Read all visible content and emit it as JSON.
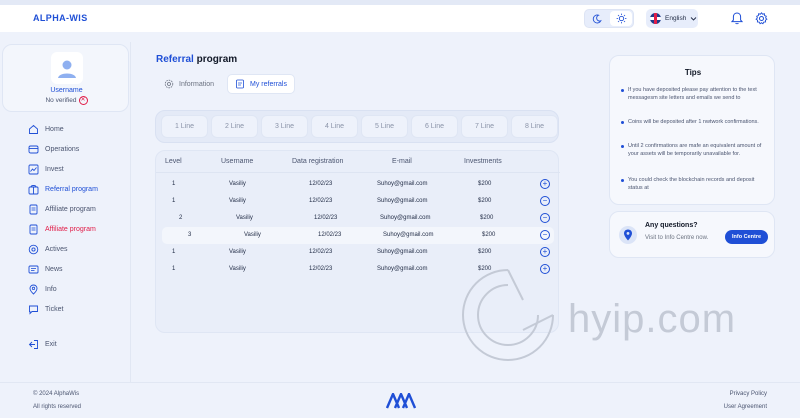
{
  "header": {
    "logo": "ALPHA-WIS",
    "language": "English",
    "theme": {
      "dark_icon": "moon-icon",
      "light_icon": "sun-icon",
      "selected": "light"
    }
  },
  "sidebar": {
    "username": "Username",
    "verification_status": "No verified",
    "items": [
      {
        "label": "Home",
        "icon": "home-icon",
        "state": "normal"
      },
      {
        "label": "Operations",
        "icon": "operations-icon",
        "state": "normal"
      },
      {
        "label": "Invest",
        "icon": "invest-icon",
        "state": "normal"
      },
      {
        "label": "Referral program",
        "icon": "referral-icon",
        "state": "active"
      },
      {
        "label": "Affiliate program",
        "icon": "affiliate-icon",
        "state": "normal"
      },
      {
        "label": "Affiliate program",
        "icon": "affiliate-icon",
        "state": "alert"
      },
      {
        "label": "Actives",
        "icon": "actives-icon",
        "state": "normal"
      },
      {
        "label": "News",
        "icon": "news-icon",
        "state": "normal"
      },
      {
        "label": "Info",
        "icon": "info-icon",
        "state": "normal"
      },
      {
        "label": "Ticket",
        "icon": "ticket-icon",
        "state": "normal"
      }
    ],
    "exit_label": "Exit"
  },
  "main": {
    "title_accent": "Referral",
    "title_rest": "program",
    "tabs": [
      {
        "label": "Information",
        "active": false
      },
      {
        "label": "My referrals",
        "active": true
      }
    ],
    "lines": [
      "1 Line",
      "2 Line",
      "3 Line",
      "4 Line",
      "5 Line",
      "6 Line",
      "7 Line",
      "8 Line"
    ],
    "table": {
      "headers": [
        "Level",
        "Username",
        "Data registration",
        "E-mail",
        "Investments"
      ],
      "rows": [
        {
          "level": "1",
          "username": "Vasiliy",
          "date": "12/02/23",
          "email": "Suhoy@gmail.com",
          "investment": "$200",
          "action": "+"
        },
        {
          "level": "1",
          "username": "Vasiliy",
          "date": "12/02/23",
          "email": "Suhoy@gmail.com",
          "investment": "$200",
          "action": "−"
        },
        {
          "level": "2",
          "username": "Vasiliy",
          "date": "12/02/23",
          "email": "Suhoy@gmail.com",
          "investment": "$200",
          "action": "−"
        },
        {
          "level": "3",
          "username": "Vasiliy",
          "date": "12/02/23",
          "email": "Suhoy@gmail.com",
          "investment": "$200",
          "action": "−"
        },
        {
          "level": "1",
          "username": "Vasiliy",
          "date": "12/02/23",
          "email": "Suhoy@gmail.com",
          "investment": "$200",
          "action": "+"
        },
        {
          "level": "1",
          "username": "Vasiliy",
          "date": "12/02/23",
          "email": "Suhoy@gmail.com",
          "investment": "$200",
          "action": "+"
        }
      ]
    }
  },
  "tips": {
    "title": "Tips",
    "items": [
      "If you have deposited please pay attention to the text messagesm site letters and emails we send to",
      "Coins will be deposited after 1 nwtwork confirmations.",
      "Until 2 confirmations are mafe an equivalent amount of your assets will be temporarily unavailable for.",
      "You could check the blockchain records and deposit status at"
    ]
  },
  "questions": {
    "title": "Any questions?",
    "subtitle": "Visit to Info Centre now.",
    "button": "Info Centre"
  },
  "watermark": "hyip.com",
  "footer": {
    "copyright": "© 2024 AlphaWis",
    "rights": "All rights reserved",
    "privacy": "Privacy Policy",
    "agreement": "User Agreement"
  },
  "colors": {
    "accent": "#1f4fd6",
    "alert": "#e11d48",
    "background": "#eef2fb"
  }
}
